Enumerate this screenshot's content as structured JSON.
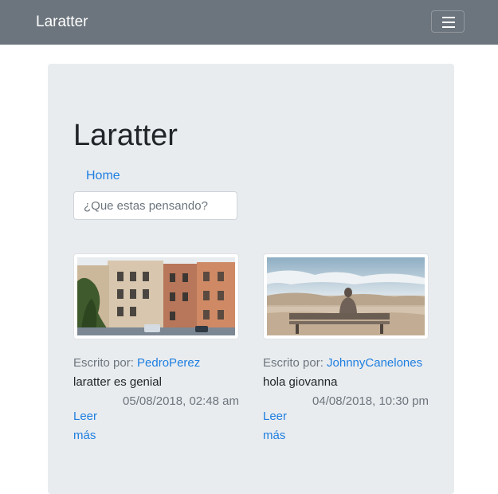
{
  "navbar": {
    "brand": "Laratter",
    "toggle_icon": "hamburger-icon",
    "background": "#6c757d"
  },
  "main": {
    "title": "Laratter",
    "nav_home": "Home",
    "status_input": {
      "placeholder": "¿Que estas pensando?",
      "value": ""
    }
  },
  "cards": [
    {
      "image": "street-buildings-photo",
      "written_by_label": "Escrito por:",
      "author": "PedroPerez",
      "content": "laratter es genial",
      "date": "05/08/2018, 02:48 am",
      "read_more": "Leer más"
    },
    {
      "image": "person-on-bench-photo",
      "written_by_label": "Escrito por:",
      "author": "JohnnyCanelones",
      "content": "hola giovanna",
      "date": "04/08/2018, 10:30 pm",
      "read_more": "Leer más"
    }
  ],
  "colors": {
    "link": "#1e7fe0",
    "jumbotron": "#e9ecef",
    "muted": "#6c757d"
  }
}
